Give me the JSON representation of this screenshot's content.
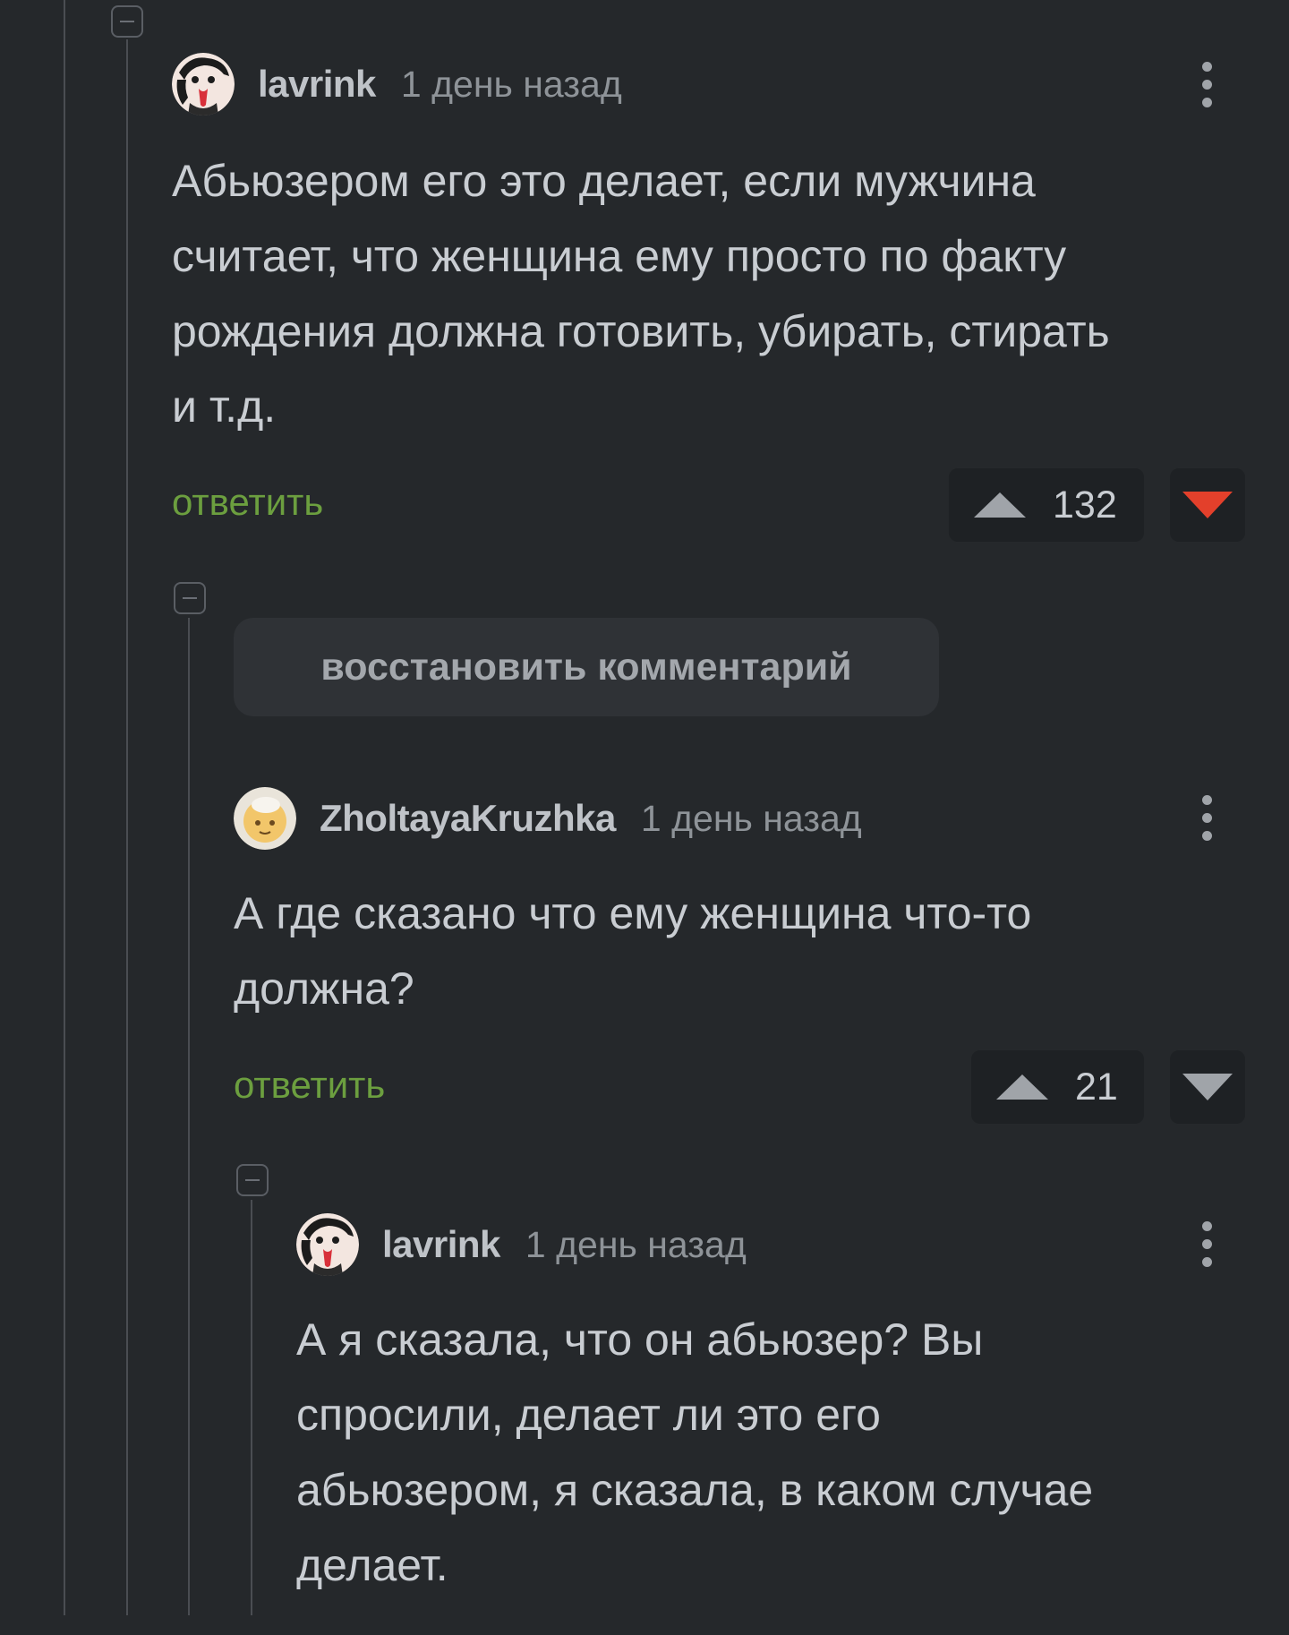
{
  "comments": [
    {
      "author": "lavrink",
      "time": "1 день назад",
      "text": "Абьюзером его это делает, если мужчина\nсчитает, что женщина ему просто по факту\nрождения должна готовить, убирать, стирать\nи т.д.",
      "reply_label": "ответить",
      "score": "132",
      "downvote_state": "active",
      "avatar_icon": "anime-character-avatar"
    },
    {
      "author": "ZholtayaKruzhka",
      "time": "1 день назад",
      "text": "А где сказано что ему женщина что-то\nдолжна?",
      "reply_label": "ответить",
      "score": "21",
      "downvote_state": "inactive",
      "avatar_icon": "yellow-round-avatar"
    },
    {
      "author": "lavrink",
      "time": "1 день назад",
      "text": "А я сказала, что он абьюзер? Вы\nспросили, делает ли это его\nабьюзером, я сказала, в каком случае\nделает.",
      "avatar_icon": "anime-character-avatar"
    }
  ],
  "restore_comment_label": "восстановить комментарий",
  "colors": {
    "background": "#25282b",
    "reply_link": "#6c9f3f",
    "downvote_active": "#e3402b"
  }
}
